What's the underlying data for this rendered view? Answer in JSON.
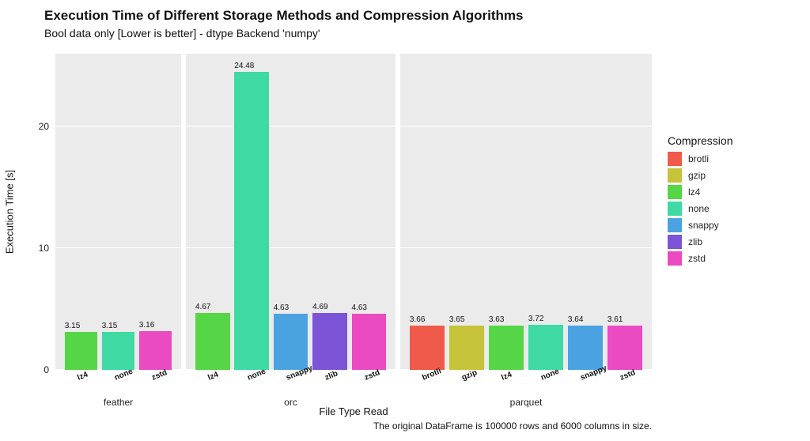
{
  "title": "Execution Time of Different Storage Methods and Compression Algorithms",
  "subtitle": "Bool data only [Lower is better] - dtype Backend 'numpy'",
  "ylabel": "Execution Time [s]",
  "xlabel": "File Type Read",
  "caption": "The original DataFrame is 100000 rows and 6000 columns in size.",
  "legend_title": "Compression",
  "y_ticks": [
    0,
    10,
    20
  ],
  "colors": {
    "brotli": "#f05a4a",
    "gzip": "#c6c23a",
    "lz4": "#56d646",
    "none": "#3fd9a4",
    "snappy": "#4aa3e0",
    "zlib": "#7c55d6",
    "zstd": "#ea4bc3"
  },
  "compression_order": [
    "brotli",
    "gzip",
    "lz4",
    "none",
    "snappy",
    "zlib",
    "zstd"
  ],
  "chart_data": {
    "type": "bar",
    "facets": [
      "feather",
      "orc",
      "parquet"
    ],
    "ylim": [
      0,
      26
    ],
    "series": [
      {
        "facet": "feather",
        "compression": "lz4",
        "value": 3.15
      },
      {
        "facet": "feather",
        "compression": "none",
        "value": 3.15
      },
      {
        "facet": "feather",
        "compression": "zstd",
        "value": 3.16
      },
      {
        "facet": "orc",
        "compression": "lz4",
        "value": 4.67
      },
      {
        "facet": "orc",
        "compression": "none",
        "value": 24.48
      },
      {
        "facet": "orc",
        "compression": "snappy",
        "value": 4.63
      },
      {
        "facet": "orc",
        "compression": "zlib",
        "value": 4.69
      },
      {
        "facet": "orc",
        "compression": "zstd",
        "value": 4.63
      },
      {
        "facet": "parquet",
        "compression": "brotli",
        "value": 3.66
      },
      {
        "facet": "parquet",
        "compression": "gzip",
        "value": 3.65
      },
      {
        "facet": "parquet",
        "compression": "lz4",
        "value": 3.63
      },
      {
        "facet": "parquet",
        "compression": "none",
        "value": 3.72
      },
      {
        "facet": "parquet",
        "compression": "snappy",
        "value": 3.64
      },
      {
        "facet": "parquet",
        "compression": "zstd",
        "value": 3.61
      }
    ]
  }
}
